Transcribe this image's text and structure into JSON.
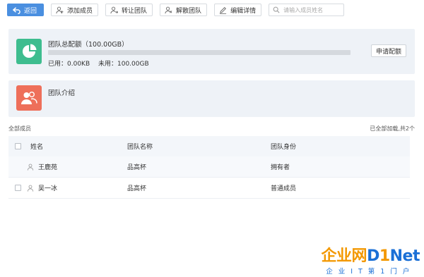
{
  "toolbar": {
    "back_label": "返回",
    "add_member_label": "添加成员",
    "transfer_team_label": "转让团队",
    "dissolve_team_label": "解散团队",
    "edit_details_label": "编辑详情",
    "search_placeholder": "请输入成员姓名"
  },
  "quota": {
    "title": "团队总配额（100.00GB）",
    "used_label": "已用：0.00KB",
    "unused_label": "未用：100.00GB",
    "used_fraction": 0.0,
    "apply_label": "申请配额"
  },
  "intro": {
    "title": "团队介绍"
  },
  "members": {
    "all_label": "全部成员",
    "loaded_label": "已全部加载,共2个",
    "columns": [
      "姓名",
      "团队名称",
      "团队身份"
    ],
    "rows": [
      {
        "name": "王鹿苑",
        "team": "品高杯",
        "role": "拥有者"
      },
      {
        "name": "吴一冰",
        "team": "品高杯",
        "role": "普通成员"
      }
    ]
  },
  "watermark": {
    "logo_orange": "企业网",
    "logo_blue_1": "D",
    "logo_orange_2": "1",
    "logo_blue_2": "Net",
    "subtitle": "企业IT第1门户"
  },
  "colors": {
    "primary": "#4a8fe0",
    "quota_icon": "#3ebd8f",
    "intro_icon": "#ee6f5a",
    "card_bg": "#eef2f7"
  },
  "icons": [
    "back-arrow-icon",
    "add-user-icon",
    "transfer-icon",
    "dissolve-icon",
    "edit-icon",
    "search-icon",
    "pie-chart-icon",
    "team-icon",
    "user-icon"
  ]
}
